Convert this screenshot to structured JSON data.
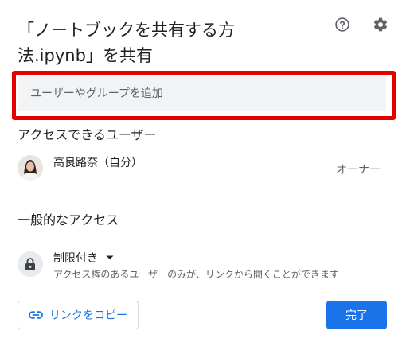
{
  "dialog": {
    "title": "「ノートブックを共有する方法.ipynb」を共有",
    "help_icon": "help-circle-icon",
    "settings_icon": "gear-icon"
  },
  "add_people": {
    "placeholder": "ユーザーやグループを追加",
    "highlight_color": "#e60000"
  },
  "people_with_access": {
    "heading": "アクセスできるユーザー",
    "users": [
      {
        "name": "高良路奈（自分）",
        "role": "オーナー",
        "avatar_icon": "user-avatar"
      }
    ]
  },
  "general_access": {
    "heading": "一般的なアクセス",
    "lock_icon": "lock-icon",
    "selected_option": "制限付き",
    "dropdown_icon": "caret-down-icon",
    "description": "アクセス権のあるユーザーのみが、リンクから開くことができます"
  },
  "footer": {
    "copy_link_label": "リンクをコピー",
    "copy_link_icon": "link-icon",
    "done_label": "完了"
  },
  "colors": {
    "accent": "#1a73e8",
    "input_background": "#f1f3f4",
    "secondary_text": "#5f6368"
  }
}
